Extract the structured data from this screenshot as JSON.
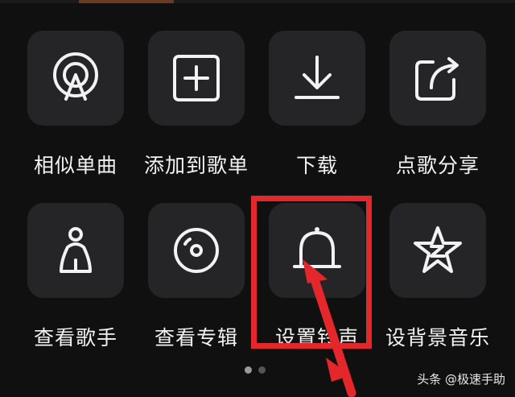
{
  "menu": {
    "items": [
      {
        "label": "相似单曲",
        "icon": "similar-song-icon"
      },
      {
        "label": "添加到歌单",
        "icon": "add-to-playlist-icon"
      },
      {
        "label": "下载",
        "icon": "download-icon"
      },
      {
        "label": "点歌分享",
        "icon": "share-icon"
      },
      {
        "label": "查看歌手",
        "icon": "singer-icon"
      },
      {
        "label": "查看专辑",
        "icon": "album-disc-icon"
      },
      {
        "label": "设置铃声",
        "icon": "bell-icon"
      },
      {
        "label": "设背景音乐",
        "icon": "star-z-icon"
      }
    ]
  },
  "pager": {
    "pages": 2,
    "current": 1
  },
  "annotation": {
    "highlighted_item": "设置铃声",
    "color": "#e3272b"
  },
  "watermark": {
    "text": "头条 @极速手助"
  },
  "colors": {
    "background": "#101011",
    "tile": "#252527",
    "text": "#f2f2f2"
  }
}
